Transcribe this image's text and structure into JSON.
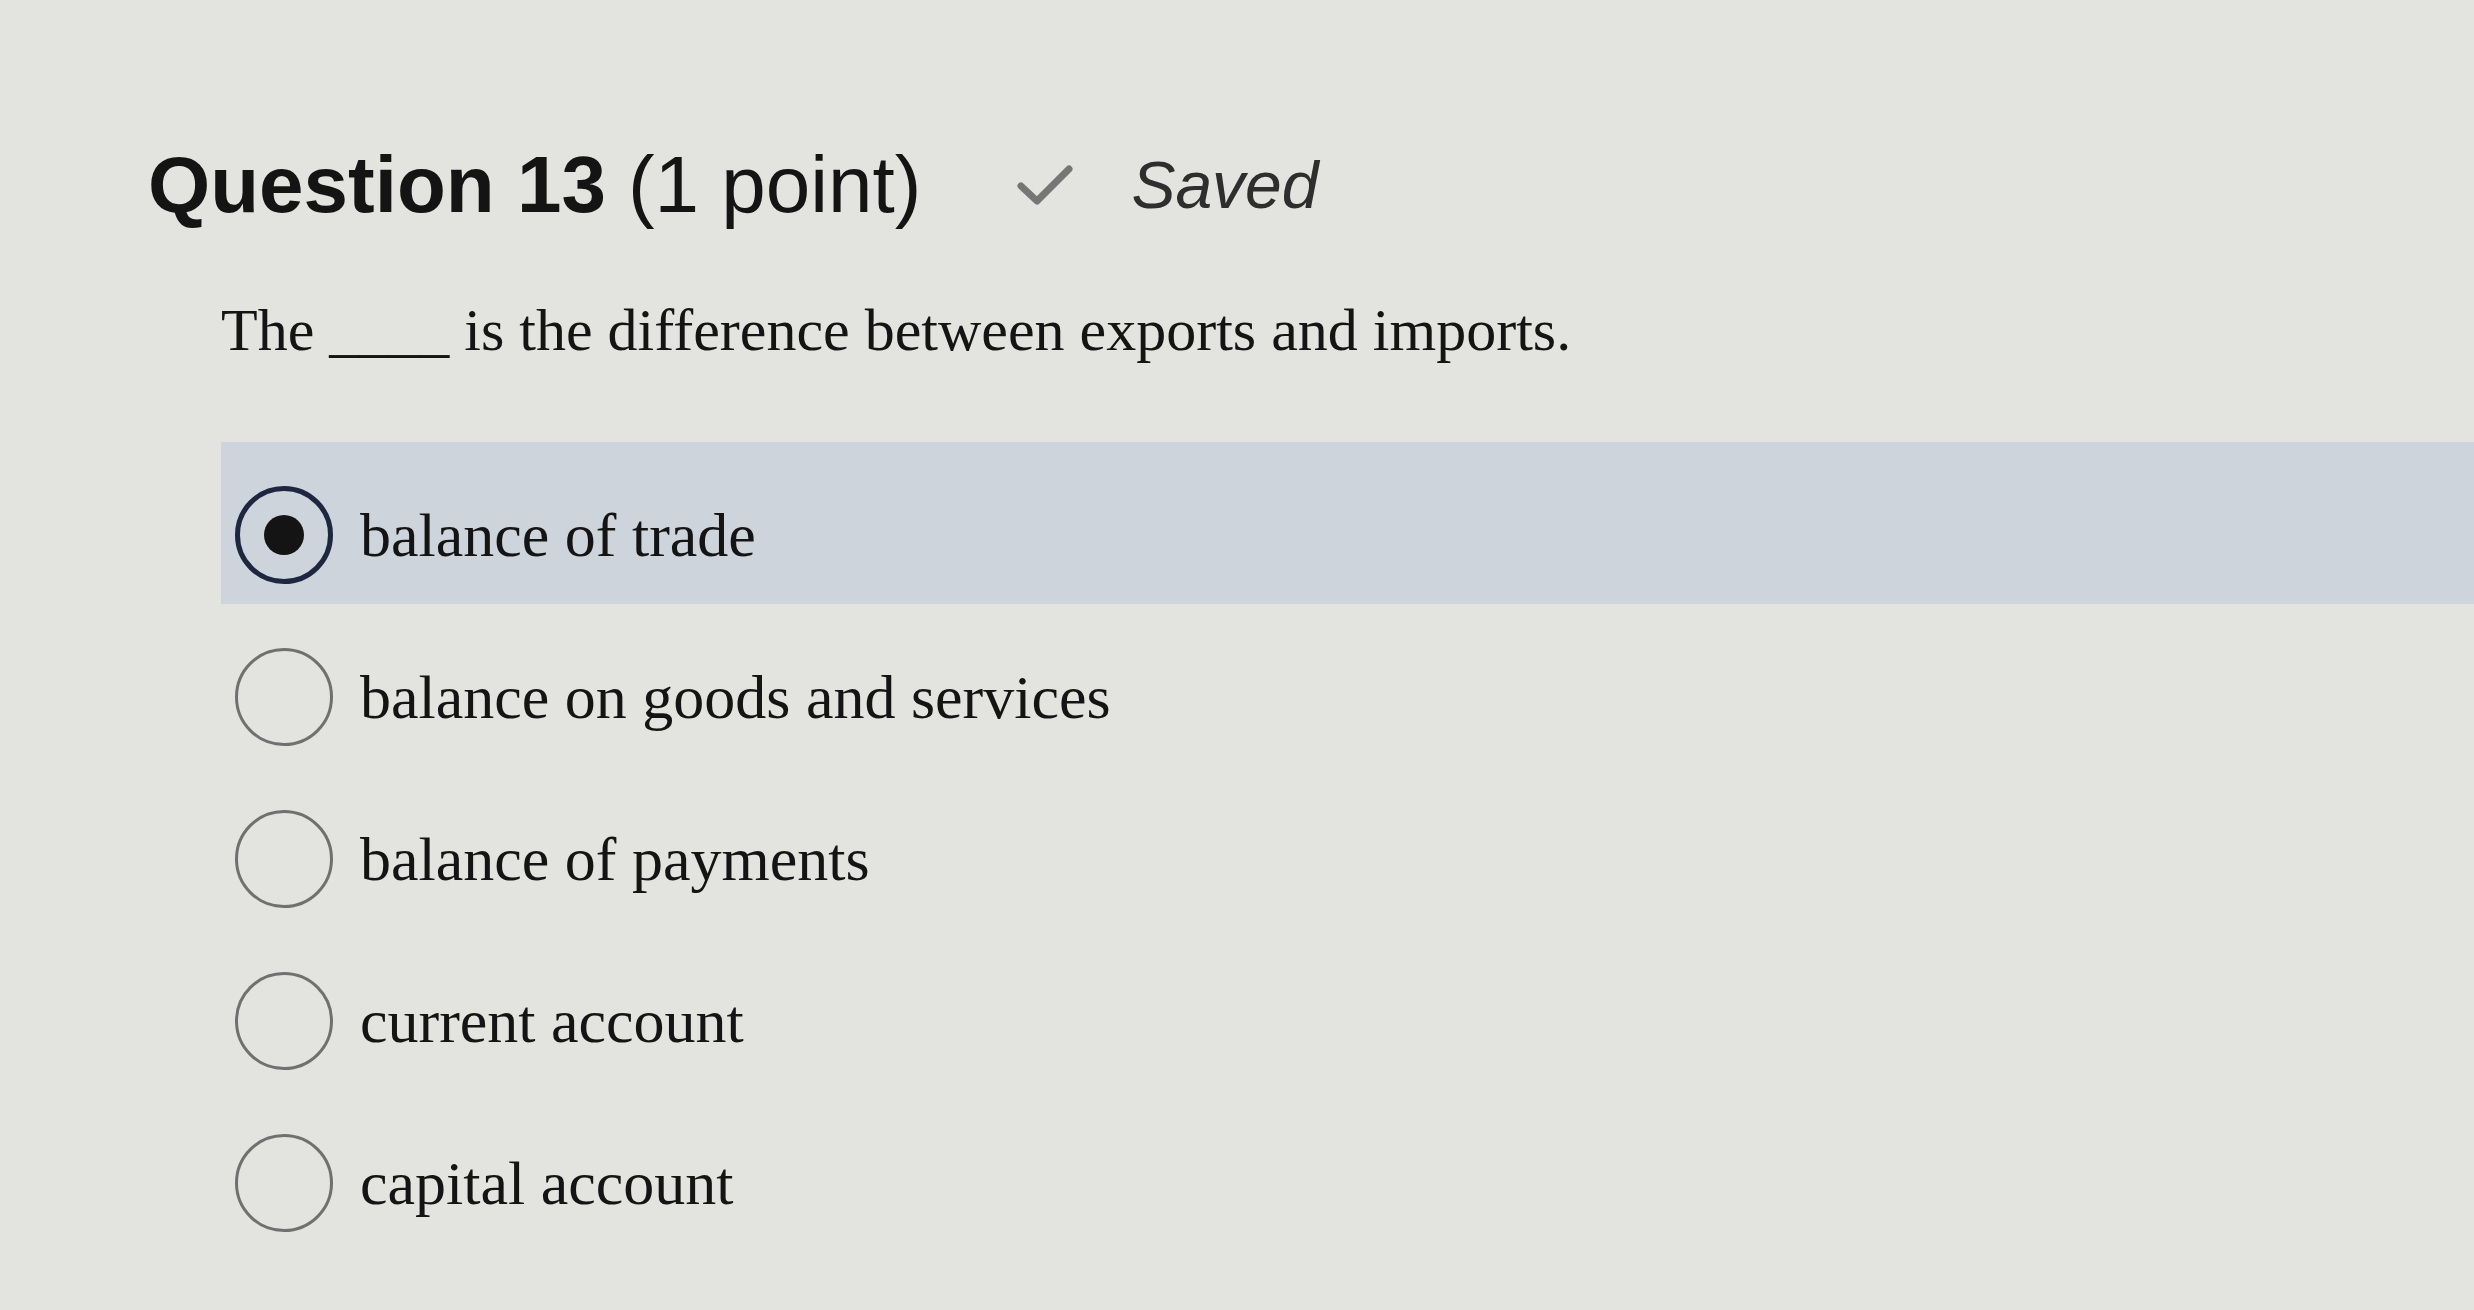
{
  "question": {
    "title": "Question 13",
    "points": "(1 point)",
    "status": "Saved",
    "text": "The ____ is the difference between exports and imports."
  },
  "options": [
    {
      "label": "balance of trade",
      "selected": true
    },
    {
      "label": "balance on goods and services",
      "selected": false
    },
    {
      "label": "balance of payments",
      "selected": false
    },
    {
      "label": "current account",
      "selected": false
    },
    {
      "label": "capital account",
      "selected": false
    }
  ]
}
